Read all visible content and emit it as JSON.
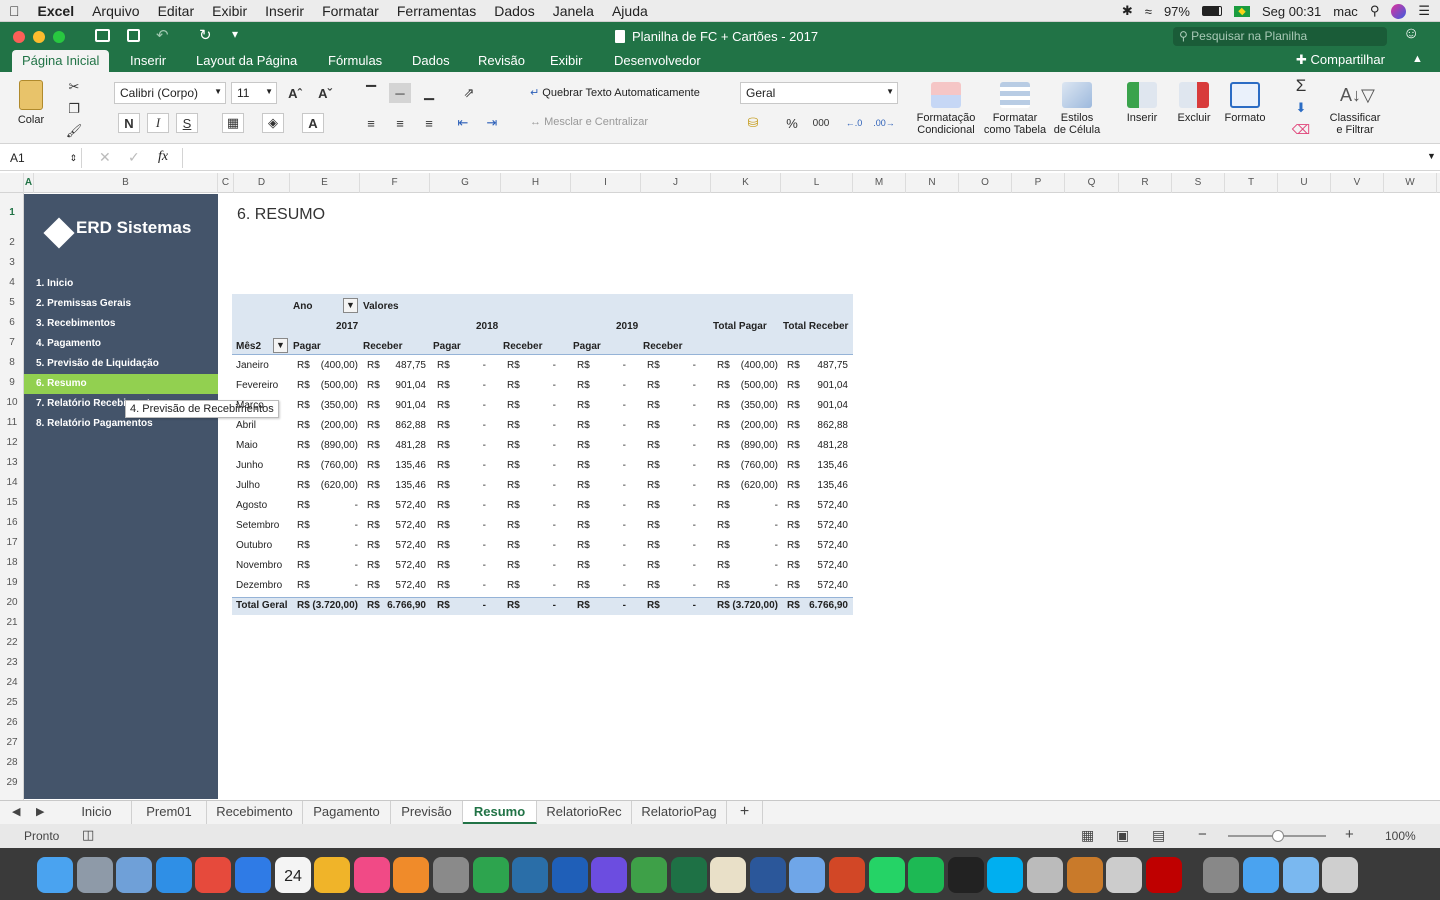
{
  "menubar": {
    "app": "Excel",
    "items": [
      "Arquivo",
      "Editar",
      "Exibir",
      "Inserir",
      "Formatar",
      "Ferramentas",
      "Dados",
      "Janela",
      "Ajuda"
    ],
    "battery": "97%",
    "clock": "Seg 00:31",
    "user": "mac"
  },
  "window": {
    "title": "Planilha de FC + Cartões - 2017",
    "search_placeholder": "Pesquisar na Planilha"
  },
  "ribbon_tabs": [
    "Página Inicial",
    "Inserir",
    "Layout da Página",
    "Fórmulas",
    "Dados",
    "Revisão",
    "Exibir",
    "Desenvolvedor"
  ],
  "share_label": "Compartilhar",
  "ribbon": {
    "paste": "Colar",
    "font_name": "Calibri (Corpo)",
    "font_size": "11",
    "bold": "N",
    "italic": "I",
    "underline": "S",
    "wrap_text": "Quebrar Texto Automaticamente",
    "merge_center": "Mesclar e Centralizar",
    "number_format": "Geral",
    "percent": "%",
    "thousands": "000",
    "cond_format": [
      "Formatação",
      "Condicional"
    ],
    "format_table": [
      "Formatar",
      "como Tabela"
    ],
    "cell_styles": [
      "Estilos",
      "de Célula"
    ],
    "insert": "Inserir",
    "delete": "Excluir",
    "format": "Formato",
    "sort_filter": [
      "Classificar",
      "e Filtrar"
    ]
  },
  "formula_bar": {
    "name_box": "A1",
    "fx": "fx",
    "value": ""
  },
  "columns": [
    "A",
    "B",
    "C",
    "D",
    "E",
    "F",
    "G",
    "H",
    "I",
    "J",
    "K",
    "L",
    "M",
    "N",
    "O",
    "P",
    "Q",
    "R",
    "S",
    "T",
    "U",
    "V",
    "W"
  ],
  "rows": [
    "1",
    "2",
    "3",
    "4",
    "5",
    "6",
    "7",
    "8",
    "9",
    "10",
    "11",
    "12",
    "13",
    "14",
    "15",
    "16",
    "17",
    "18",
    "19",
    "20",
    "21",
    "22",
    "23",
    "24",
    "25",
    "26",
    "27",
    "28",
    "29"
  ],
  "sidebar": {
    "brand": "ERD Sistemas",
    "items": [
      "1. Inicio",
      "2. Premissas Gerais",
      "3. Recebimentos",
      "4. Pagamento",
      "5. Previsão de Liquidação",
      "6. Resumo",
      "7. Relatório Recebimentos",
      "8. Relatório Pagamentos"
    ],
    "active_index": 5,
    "tooltip": "4. Previsão de Recebimentos"
  },
  "sheet_title": "6. RESUMO",
  "pivot": {
    "header_ano": "Ano",
    "header_valores": "Valores",
    "years": [
      "2017",
      "2018",
      "2019"
    ],
    "total_pagar": "Total Pagar",
    "total_receber": "Total Receber",
    "row_field": "Mês2",
    "pagar": "Pagar",
    "receber": "Receber",
    "currency": "R$",
    "dash": "-",
    "rows": [
      {
        "mes": "Janeiro",
        "p17": "(400,00)",
        "r17": "487,75",
        "tp": "(400,00)",
        "tr": "487,75"
      },
      {
        "mes": "Fevereiro",
        "p17": "(500,00)",
        "r17": "901,04",
        "tp": "(500,00)",
        "tr": "901,04"
      },
      {
        "mes": "Março",
        "p17": "(350,00)",
        "r17": "901,04",
        "tp": "(350,00)",
        "tr": "901,04"
      },
      {
        "mes": "Abril",
        "p17": "(200,00)",
        "r17": "862,88",
        "tp": "(200,00)",
        "tr": "862,88"
      },
      {
        "mes": "Maio",
        "p17": "(890,00)",
        "r17": "481,28",
        "tp": "(890,00)",
        "tr": "481,28"
      },
      {
        "mes": "Junho",
        "p17": "(760,00)",
        "r17": "135,46",
        "tp": "(760,00)",
        "tr": "135,46"
      },
      {
        "mes": "Julho",
        "p17": "(620,00)",
        "r17": "135,46",
        "tp": "(620,00)",
        "tr": "135,46"
      },
      {
        "mes": "Agosto",
        "p17": "-",
        "r17": "572,40",
        "tp": "-",
        "tr": "572,40"
      },
      {
        "mes": "Setembro",
        "p17": "-",
        "r17": "572,40",
        "tp": "-",
        "tr": "572,40"
      },
      {
        "mes": "Outubro",
        "p17": "-",
        "r17": "572,40",
        "tp": "-",
        "tr": "572,40"
      },
      {
        "mes": "Novembro",
        "p17": "-",
        "r17": "572,40",
        "tp": "-",
        "tr": "572,40"
      },
      {
        "mes": "Dezembro",
        "p17": "-",
        "r17": "572,40",
        "tp": "-",
        "tr": "572,40"
      }
    ],
    "total": {
      "mes": "Total Geral",
      "p17": "(3.720,00)",
      "r17": "6.766,90",
      "tp": "(3.720,00)",
      "tr": "6.766,90"
    }
  },
  "sheet_tabs": [
    "Inicio",
    "Prem01",
    "Recebimento",
    "Pagamento",
    "Previsão",
    "Resumo",
    "RelatorioRec",
    "RelatorioPag"
  ],
  "active_sheet": "Resumo",
  "status": {
    "ready": "Pronto",
    "zoom": "100%"
  },
  "dock_icons": [
    "finder-icon",
    "launchpad-icon",
    "preview-icon",
    "safari-icon",
    "chrome-icon",
    "app-store-icon",
    "calendar-icon",
    "photos-icon",
    "itunes-icon",
    "ibooks-icon",
    "system-preferences-icon",
    "evernote-icon",
    "mysql-workbench-icon",
    "quicktime-icon",
    "imovie-icon",
    "numbers-icon",
    "excel-icon",
    "textedit-icon",
    "word-icon",
    "keynote-icon",
    "powerpoint-icon",
    "whatsapp-icon",
    "spotify-icon",
    "activity-monitor-icon",
    "skype-icon",
    "utility-icon",
    "sublime-icon",
    "script-editor-icon",
    "filezilla-icon",
    "printer-icon",
    "folder-icon",
    "downloads-icon",
    "trash-icon"
  ],
  "calendar_day": "24"
}
